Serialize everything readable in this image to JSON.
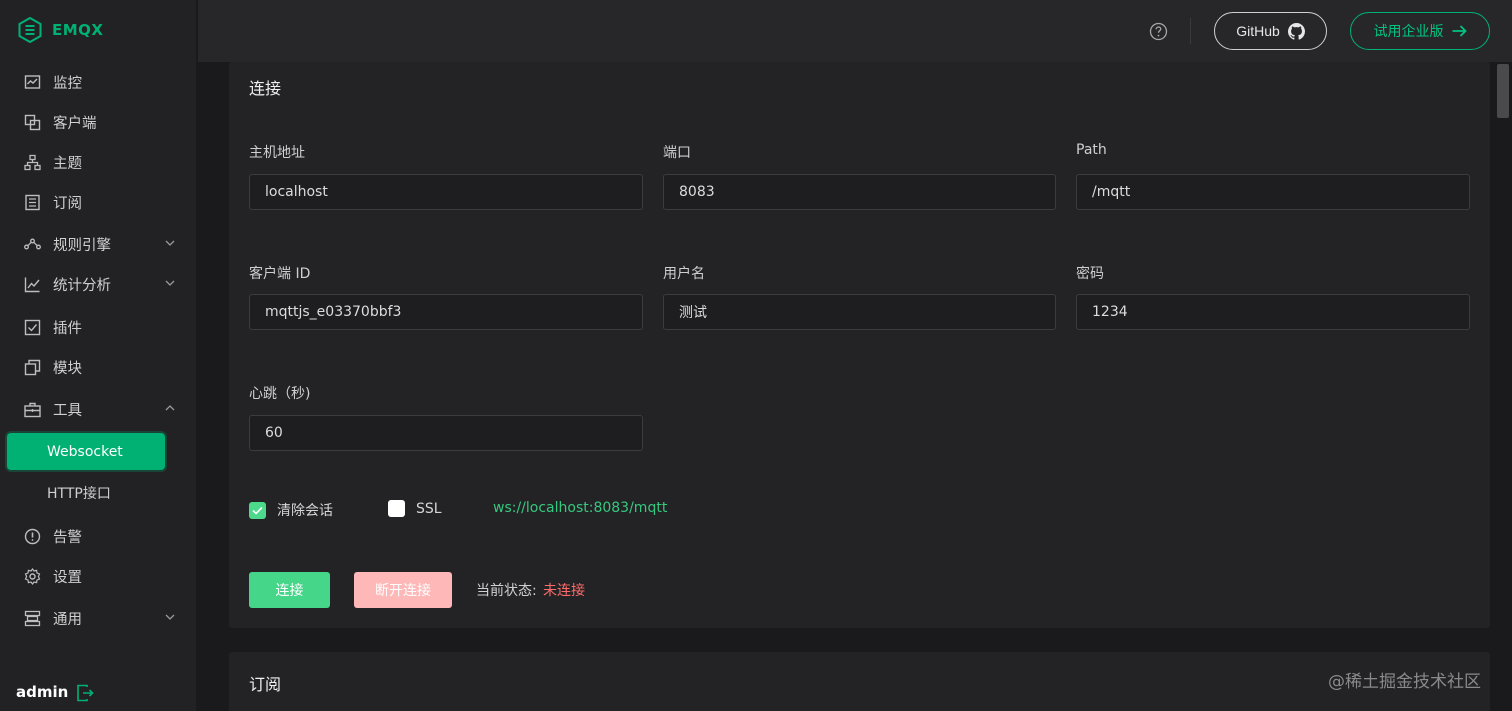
{
  "brand": {
    "name": "EMQX",
    "accent": "#00b173"
  },
  "sidebar": {
    "items": [
      {
        "label": "监控",
        "icon": "monitor-icon"
      },
      {
        "label": "客户端",
        "icon": "clients-icon"
      },
      {
        "label": "主题",
        "icon": "topics-icon"
      },
      {
        "label": "订阅",
        "icon": "subscriptions-icon"
      },
      {
        "label": "规则引擎",
        "icon": "rule-engine-icon"
      },
      {
        "label": "统计分析",
        "icon": "analytics-icon"
      },
      {
        "label": "插件",
        "icon": "plugins-icon"
      },
      {
        "label": "模块",
        "icon": "modules-icon"
      },
      {
        "label": "工具",
        "icon": "tools-icon"
      },
      {
        "label": "告警",
        "icon": "alarm-icon"
      },
      {
        "label": "设置",
        "icon": "settings-icon"
      },
      {
        "label": "通用",
        "icon": "general-icon"
      }
    ],
    "tools_sub": [
      {
        "label": "Websocket"
      },
      {
        "label": "HTTP接口"
      }
    ],
    "user": "admin"
  },
  "header": {
    "github_label": "GitHub",
    "trial_label": "试用企业版"
  },
  "connect": {
    "title": "连接",
    "host": {
      "label": "主机地址",
      "value": "localhost"
    },
    "port": {
      "label": "端口",
      "value": "8083"
    },
    "path": {
      "label": "Path",
      "value": "/mqtt"
    },
    "client_id": {
      "label": "客户端 ID",
      "value": "mqttjs_e03370bbf3"
    },
    "username": {
      "label": "用户名",
      "value": "测试"
    },
    "password": {
      "label": "密码",
      "value": "1234"
    },
    "keepalive": {
      "label": "心跳（秒)",
      "value": "60"
    },
    "clean_session": {
      "label": "清除会话",
      "checked": true
    },
    "ssl": {
      "label": "SSL",
      "checked": false
    },
    "ws_url": "ws://localhost:8083/mqtt",
    "connect_button": "连接",
    "disconnect_button": "断开连接",
    "status_label": "当前状态:",
    "status_value": "未连接"
  },
  "subscribe": {
    "title": "订阅"
  },
  "watermark": "@稀土掘金技术社区"
}
